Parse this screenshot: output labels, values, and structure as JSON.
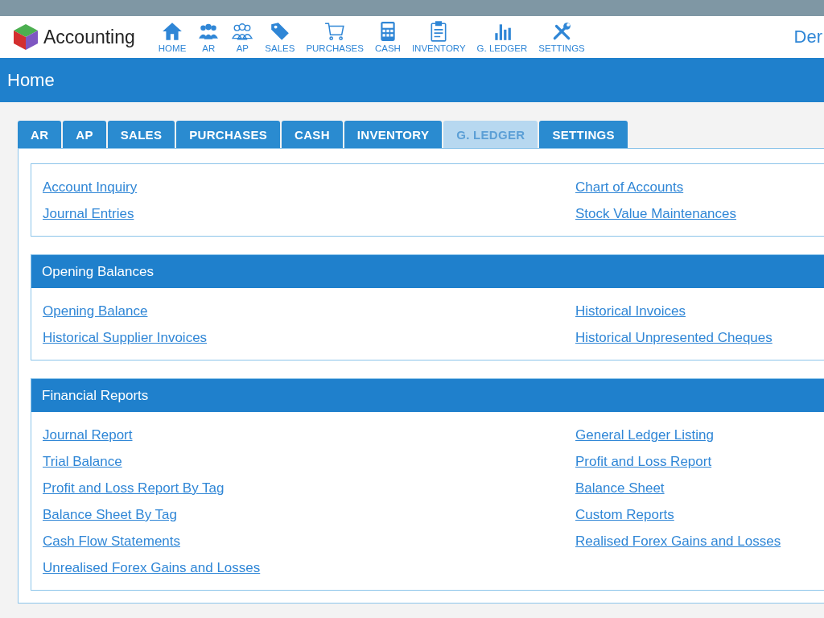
{
  "app": {
    "name": "Accounting",
    "user": "Der"
  },
  "nav": [
    {
      "kind": "home",
      "label": "HOME"
    },
    {
      "kind": "people",
      "label": "AR"
    },
    {
      "kind": "people-outline",
      "label": "AP"
    },
    {
      "kind": "tag",
      "label": "SALES"
    },
    {
      "kind": "cart",
      "label": "PURCHASES"
    },
    {
      "kind": "calculator",
      "label": "CASH"
    },
    {
      "kind": "clipboard",
      "label": "INVENTORY"
    },
    {
      "kind": "chart",
      "label": "G. LEDGER"
    },
    {
      "kind": "tools",
      "label": "SETTINGS"
    }
  ],
  "page_title": "Home",
  "tabs": [
    {
      "label": "AR",
      "selected": false
    },
    {
      "label": "AP",
      "selected": false
    },
    {
      "label": "SALES",
      "selected": false
    },
    {
      "label": "PURCHASES",
      "selected": false
    },
    {
      "label": "CASH",
      "selected": false
    },
    {
      "label": "INVENTORY",
      "selected": false
    },
    {
      "label": "G. LEDGER",
      "selected": true
    },
    {
      "label": "SETTINGS",
      "selected": false
    }
  ],
  "sections": [
    {
      "links": [
        "Account Inquiry",
        "Chart of Accounts",
        "Journal Entries",
        "Stock Value Maintenances"
      ]
    },
    {
      "title": "Opening Balances",
      "links": [
        "Opening Balance",
        "Historical Invoices",
        "Historical Supplier Invoices",
        "Historical Unpresented Cheques"
      ]
    },
    {
      "title": "Financial Reports",
      "links": [
        "Journal Report",
        "General Ledger Listing",
        "Trial Balance",
        "Profit and Loss Report",
        "Profit and Loss Report By Tag",
        "Balance Sheet",
        "Balance Sheet By Tag",
        "Custom Reports",
        "Cash Flow Statements",
        "Realised Forex Gains and Losses",
        "Unrealised Forex Gains and Losses"
      ]
    }
  ]
}
